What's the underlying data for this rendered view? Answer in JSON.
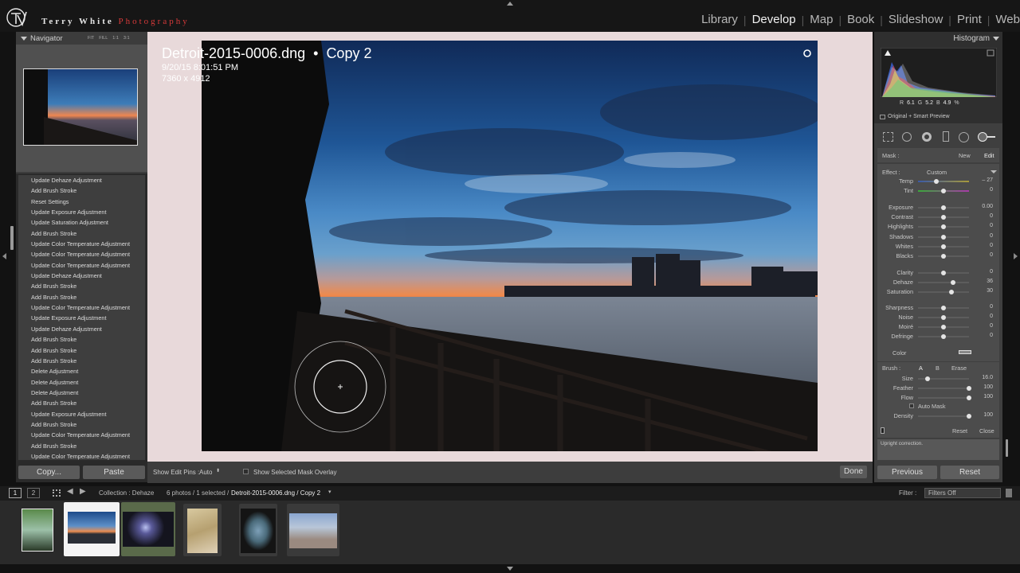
{
  "brand": {
    "name_a": "Terry White ",
    "name_b": "Photography"
  },
  "modules": [
    "Library",
    "Develop",
    "Map",
    "Book",
    "Slideshow",
    "Print",
    "Web"
  ],
  "active_module": "Develop",
  "navigator": {
    "title": "Navigator",
    "zoom_options": [
      "FIT",
      "FILL",
      "1:1",
      "3:1"
    ]
  },
  "history": [
    "Update Dehaze Adjustment",
    "Add Brush Stroke",
    "Reset Settings",
    "Update Exposure Adjustment",
    "Update Saturation Adjustment",
    "Add Brush Stroke",
    "Update Color Temperature Adjustment",
    "Update Color Temperature Adjustment",
    "Update Color Temperature Adjustment",
    "Update Dehaze Adjustment",
    "Add Brush Stroke",
    "Add Brush Stroke",
    "Update Color Temperature Adjustment",
    "Update Exposure Adjustment",
    "Update Dehaze Adjustment",
    "Add Brush Stroke",
    "Add Brush Stroke",
    "Add Brush Stroke",
    "Delete Adjustment",
    "Delete Adjustment",
    "Delete Adjustment",
    "Add Brush Stroke",
    "Update Exposure Adjustment",
    "Add Brush Stroke",
    "Update Color Temperature Adjustment",
    "Add Brush Stroke",
    "Update Color Temperature Adjustment"
  ],
  "left_buttons": {
    "copy": "Copy...",
    "paste": "Paste"
  },
  "photo": {
    "filename": "Detroit-2015-0006.dng",
    "copy": "Copy 2",
    "datetime": "9/20/15 8:01:51 PM",
    "dimensions": "7360 x 4912"
  },
  "toolbar": {
    "edit_pins_label": "Show Edit Pins :",
    "edit_pins_value": "Auto",
    "mask_overlay": "Show Selected Mask Overlay",
    "done": "Done"
  },
  "histogram": {
    "title": "Histogram",
    "r_label": "R",
    "r": "6.1",
    "g_label": "G",
    "g": "5.2",
    "b_label": "B",
    "b": "4.9",
    "pct": "%",
    "preview": "Original + Smart Preview"
  },
  "mask": {
    "label": "Mask :",
    "new": "New",
    "edit": "Edit"
  },
  "effect": {
    "label": "Effect :",
    "value": "Custom"
  },
  "adjustments": [
    {
      "label": "Temp",
      "value": "– 27",
      "pos": 0.36
    },
    {
      "label": "Tint",
      "value": "0",
      "pos": 0.5
    },
    {
      "label": "Exposure",
      "value": "0.00",
      "pos": 0.5
    },
    {
      "label": "Contrast",
      "value": "0",
      "pos": 0.5
    },
    {
      "label": "Highlights",
      "value": "0",
      "pos": 0.5
    },
    {
      "label": "Shadows",
      "value": "0",
      "pos": 0.5
    },
    {
      "label": "Whites",
      "value": "0",
      "pos": 0.5
    },
    {
      "label": "Blacks",
      "value": "0",
      "pos": 0.5
    },
    {
      "label": "Clarity",
      "value": "0",
      "pos": 0.5
    },
    {
      "label": "Dehaze",
      "value": "36",
      "pos": 0.68
    },
    {
      "label": "Saturation",
      "value": "30",
      "pos": 0.65
    },
    {
      "label": "Sharpness",
      "value": "0",
      "pos": 0.5
    },
    {
      "label": "Noise",
      "value": "0",
      "pos": 0.5
    },
    {
      "label": "Moiré",
      "value": "0",
      "pos": 0.5
    },
    {
      "label": "Defringe",
      "value": "0",
      "pos": 0.5
    }
  ],
  "color_label": "Color",
  "brush": {
    "label": "Brush :",
    "a": "A",
    "b": "B",
    "erase": "Erase",
    "params": [
      {
        "label": "Size",
        "value": "16.0",
        "pos": 0.18
      },
      {
        "label": "Feather",
        "value": "100",
        "pos": 1.0
      },
      {
        "label": "Flow",
        "value": "100",
        "pos": 1.0
      }
    ],
    "automask": "Auto Mask",
    "density": {
      "label": "Density",
      "value": "100",
      "pos": 1.0
    }
  },
  "panel_footer": {
    "reset": "Reset",
    "close": "Close"
  },
  "upright_hint": "Upright correction.",
  "right_buttons": {
    "previous": "Previous",
    "reset": "Reset"
  },
  "filmstrip_bar": {
    "page1": "1",
    "page2": "2",
    "collection": "Collection : Dehaze",
    "count": "6 photos / 1 selected /",
    "current": "Detroit-2015-0006.dng / Copy 2",
    "filter_label": "Filter :",
    "filter_value": "Filters Off"
  },
  "colors": {
    "accent_red": "#d83a3a",
    "panel_bg": "#3f3f3f",
    "canvas_bg": "#e8d9da"
  }
}
